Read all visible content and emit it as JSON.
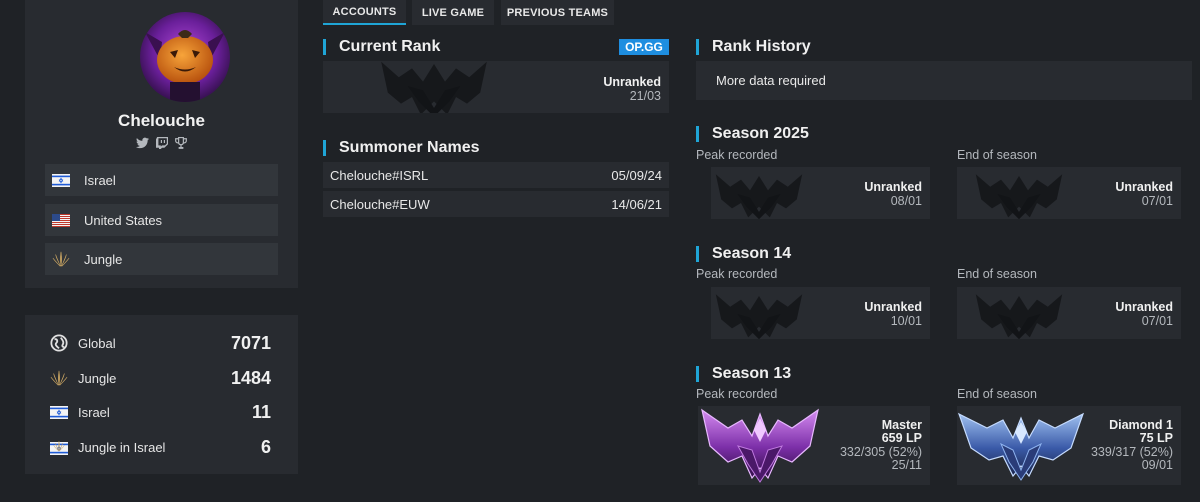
{
  "tabs": [
    {
      "label": "ACCOUNTS",
      "active": true
    },
    {
      "label": "LIVE GAME",
      "active": false
    },
    {
      "label": "PREVIOUS TEAMS",
      "active": false
    }
  ],
  "profile": {
    "name": "Chelouche",
    "socials": [
      "twitter-icon",
      "twitch-icon",
      "trophy-icon"
    ],
    "tags": [
      {
        "icon": "israel-flag-icon",
        "label": "Israel"
      },
      {
        "icon": "us-flag-icon",
        "label": "United States"
      },
      {
        "icon": "jungle-role-icon",
        "label": "Jungle"
      }
    ]
  },
  "rankings": [
    {
      "icon": "globe-icon",
      "label": "Global",
      "value": "7071"
    },
    {
      "icon": "jungle-role-icon",
      "label": "Jungle",
      "value": "1484"
    },
    {
      "icon": "israel-flag-icon",
      "label": "Israel",
      "value": "11"
    },
    {
      "icon": "jungle-israel-icon",
      "label": "Jungle in Israel",
      "value": "6"
    }
  ],
  "current_rank": {
    "title": "Current Rank",
    "badge": "OP.GG",
    "rank": "Unranked",
    "date": "21/03"
  },
  "summoner_names": {
    "title": "Summoner Names",
    "rows": [
      {
        "name": "Chelouche#ISRL",
        "date": "05/09/24"
      },
      {
        "name": "Chelouche#EUW",
        "date": "14/06/21"
      }
    ]
  },
  "rank_history": {
    "title": "Rank History",
    "message": "More data required"
  },
  "seasons": [
    {
      "title": "Season 2025",
      "peak_label": "Peak recorded",
      "end_label": "End of season",
      "peak": {
        "rank": "Unranked",
        "date": "08/01"
      },
      "end": {
        "rank": "Unranked",
        "date": "07/01"
      }
    },
    {
      "title": "Season 14",
      "peak_label": "Peak recorded",
      "end_label": "End of season",
      "peak": {
        "rank": "Unranked",
        "date": "10/01"
      },
      "end": {
        "rank": "Unranked",
        "date": "07/01"
      }
    },
    {
      "title": "Season 13",
      "peak_label": "Peak recorded",
      "end_label": "End of season",
      "peak": {
        "rank": "Master",
        "lp": "659 LP",
        "record": "332/305 (52%)",
        "date": "25/11"
      },
      "end": {
        "rank": "Diamond 1",
        "lp": "75 LP",
        "record": "339/317 (52%)",
        "date": "09/01"
      }
    }
  ],
  "colors": {
    "accent": "#1fa5d6",
    "badge": "#1e8ee0",
    "panel": "#282b30",
    "background": "#1f2226"
  }
}
